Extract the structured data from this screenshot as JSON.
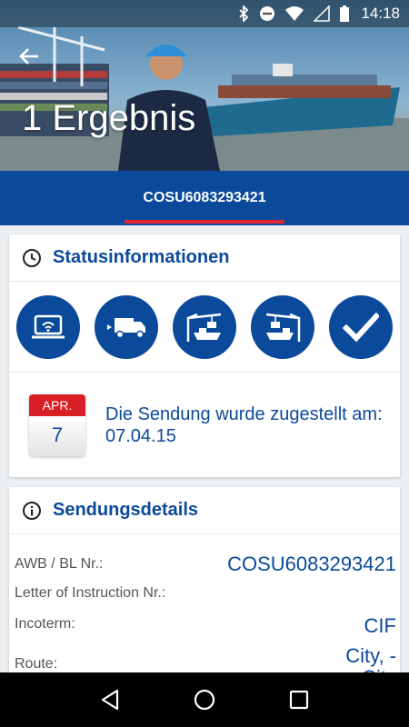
{
  "status_bar": {
    "time": "14:18",
    "icons": [
      "bluetooth-icon",
      "do-not-disturb-icon",
      "wifi-icon",
      "signal-icon",
      "battery-icon"
    ]
  },
  "header": {
    "title": "1 Ergebnis",
    "back_icon": "arrow-left-icon"
  },
  "tabs": [
    {
      "label": "COSU6083293421",
      "active": true
    }
  ],
  "status_card": {
    "title": "Statusinformationen",
    "icon": "clock-icon",
    "steps": [
      {
        "icon": "laptop-wifi-icon"
      },
      {
        "icon": "truck-icon"
      },
      {
        "icon": "crane-loading-icon"
      },
      {
        "icon": "crane-ship-icon"
      },
      {
        "icon": "checkmark-icon"
      }
    ],
    "delivery": {
      "month": "APR.",
      "day": "7",
      "message": "Die Sendung wurde zugestellt am: 07.04.15"
    }
  },
  "details_card": {
    "title": "Sendungsdetails",
    "icon": "info-icon",
    "rows": [
      {
        "label": "AWB / BL Nr.:",
        "value": "COSU6083293421"
      },
      {
        "label": "Letter of Instruction Nr.:",
        "value": ""
      },
      {
        "label": "Incoterm:",
        "value": "CIF"
      },
      {
        "label": "Route:",
        "value": "City, -City"
      }
    ]
  },
  "colors": {
    "brand_blue": "#0b4a9b",
    "accent_red": "#e3262e"
  }
}
